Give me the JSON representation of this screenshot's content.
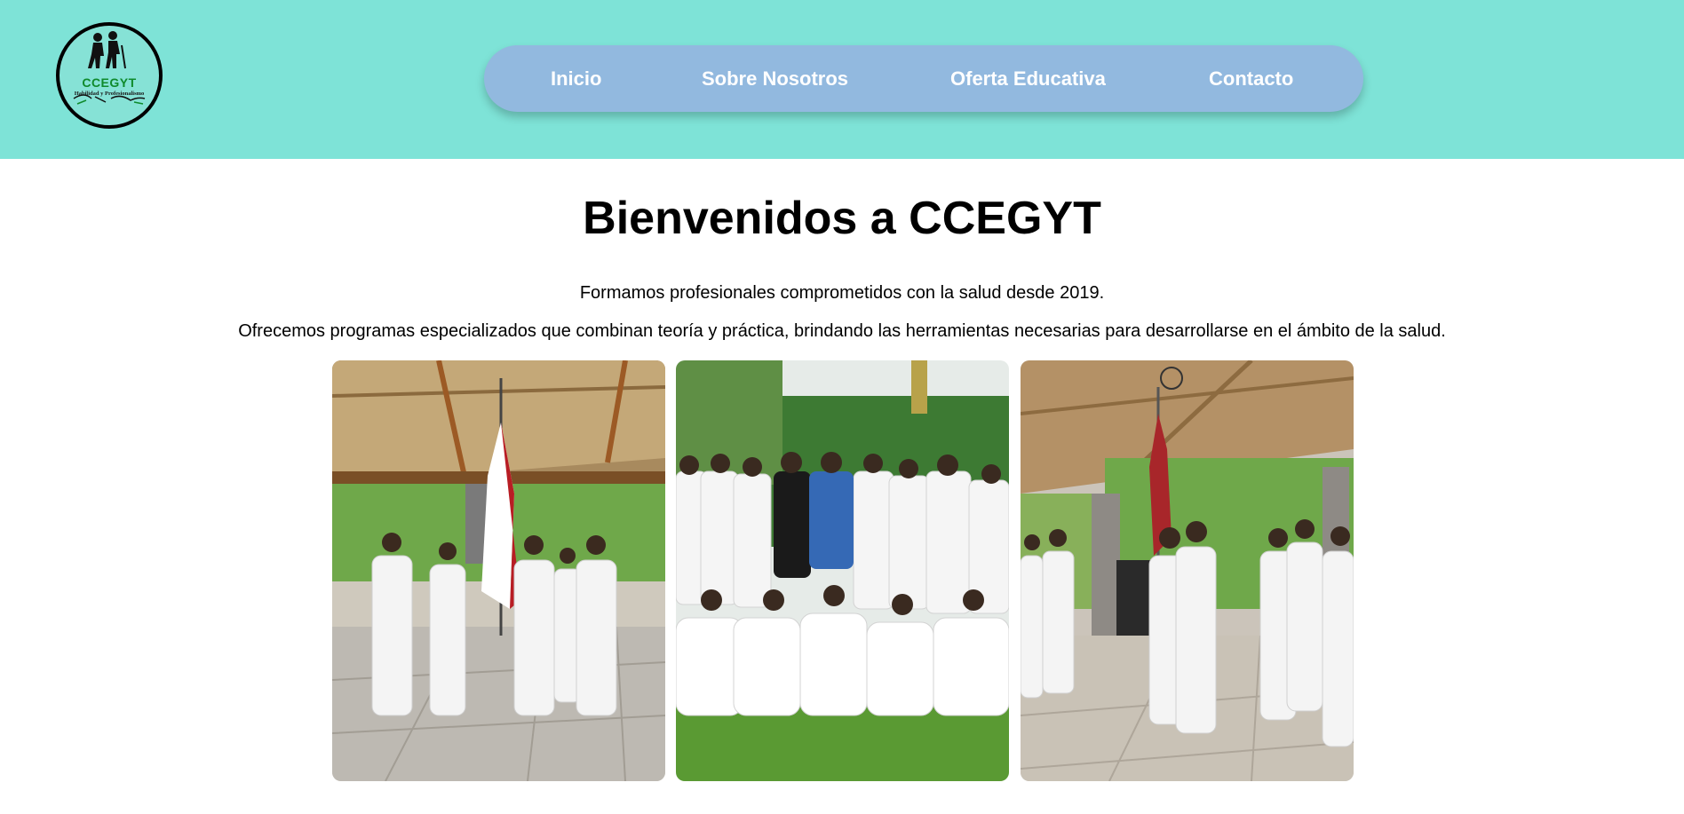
{
  "header": {
    "logo": {
      "name": "CCEGYT",
      "tagline": "Habilidad y Profesionalismo"
    },
    "nav": [
      {
        "label": "Inicio"
      },
      {
        "label": "Sobre Nosotros"
      },
      {
        "label": "Oferta Educativa"
      },
      {
        "label": "Contacto"
      }
    ]
  },
  "main": {
    "title": "Bienvenidos a CCEGYT",
    "paragraphs": [
      "Formamos profesionales comprometidos con la salud desde 2019.",
      "Ofrecemos programas especializados que combinan teoría y práctica, brindando las herramientas necesarias para desarrollarse en el ámbito de la salud."
    ]
  },
  "colors": {
    "header_bg": "#7ee3d7",
    "nav_bg": "#92b9df",
    "nav_text": "#ffffff",
    "logo_text": "#0f8a2c"
  }
}
